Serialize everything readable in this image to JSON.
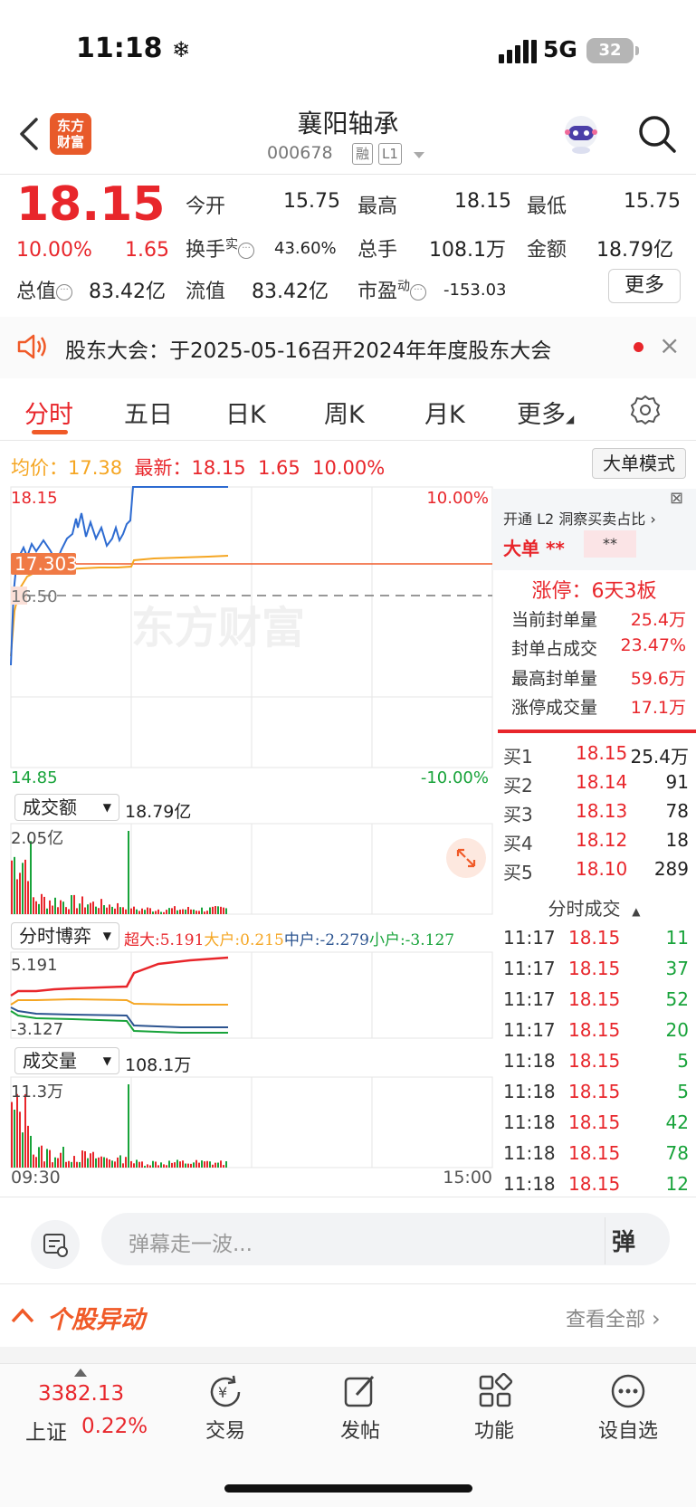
{
  "status": {
    "time": "11:18",
    "network": "5G",
    "battery": "32"
  },
  "header": {
    "logo_line1": "东方",
    "logo_line2": "财富",
    "name": "襄阳轴承",
    "code": "000678",
    "tag_margin": "融",
    "tag_level": "L1"
  },
  "quote": {
    "price": "18.15",
    "pct": "10.00%",
    "change": "1.65",
    "open_label": "今开",
    "open": "15.75",
    "high_label": "最高",
    "high": "18.15",
    "low_label": "最低",
    "low": "15.75",
    "turnover_label": "换手",
    "turnover_sup": "实",
    "turnover": "43.60%",
    "volume_label": "总手",
    "volume": "108.1万",
    "amount_label": "金额",
    "amount": "18.79亿",
    "mktcap_label": "总值",
    "mktcap": "83.42亿",
    "float_label": "流值",
    "float": "83.42亿",
    "pe_label": "市盈",
    "pe_sup": "动",
    "pe": "-153.03",
    "more": "更多"
  },
  "notice": {
    "text": "股东大会：于2025-05-16召开2024年年度股东大会"
  },
  "tabs": [
    "分时",
    "五日",
    "日K",
    "周K",
    "月K",
    "更多"
  ],
  "avg": {
    "avg_label": "均价：",
    "avg": "17.38",
    "last_label": "最新：",
    "last": "18.15",
    "chg": "1.65",
    "pct": "10.00%",
    "mode": "大单模式"
  },
  "chart": {
    "y_top": "18.15",
    "y_top_pct": "10.00%",
    "y_bot": "14.85",
    "y_bot_pct": "-10.00%",
    "cur_tag": "17.303",
    "base": "16.50",
    "watermark": "东方财富",
    "amount_sel": "成交额",
    "amount_val": "18.79亿",
    "amount_max": "2.05亿",
    "game_sel": "分时博弈",
    "game_legend": {
      "super": "超大:5.191",
      "big": "大户:0.215",
      "mid": "中户:-2.279",
      "small": "小户:-3.127"
    },
    "game_max": "5.191",
    "game_min": "-3.127",
    "vol_sel": "成交量",
    "vol_val": "108.1万",
    "vol_max": "11.3万",
    "time_start": "09:30",
    "time_end": "15:00"
  },
  "right_panel": {
    "l2_text": "开通 L2 洞察买卖占比 ›",
    "big_label": "大单",
    "big_stars": "**",
    "big_stars2": "**",
    "limit_title": "涨停：6天3板",
    "limit_rows": [
      {
        "label": "当前封单量",
        "value": "25.4万"
      },
      {
        "label": "封单占成交",
        "value": "23.47%"
      },
      {
        "label": "最高封单量",
        "value": "59.6万"
      },
      {
        "label": "涨停成交量",
        "value": "17.1万"
      }
    ],
    "bids": [
      {
        "n": "买1",
        "p": "18.15",
        "q": "25.4万"
      },
      {
        "n": "买2",
        "p": "18.14",
        "q": "91"
      },
      {
        "n": "买3",
        "p": "18.13",
        "q": "78"
      },
      {
        "n": "买4",
        "p": "18.12",
        "q": "18"
      },
      {
        "n": "买5",
        "p": "18.10",
        "q": "289"
      }
    ],
    "ticks_title": "分时成交",
    "ticks": [
      {
        "t": "11:17",
        "p": "18.15",
        "q": "11"
      },
      {
        "t": "11:17",
        "p": "18.15",
        "q": "37"
      },
      {
        "t": "11:17",
        "p": "18.15",
        "q": "52"
      },
      {
        "t": "11:17",
        "p": "18.15",
        "q": "20"
      },
      {
        "t": "11:18",
        "p": "18.15",
        "q": "5"
      },
      {
        "t": "11:18",
        "p": "18.15",
        "q": "5"
      },
      {
        "t": "11:18",
        "p": "18.15",
        "q": "42"
      },
      {
        "t": "11:18",
        "p": "18.15",
        "q": "78"
      },
      {
        "t": "11:18",
        "p": "18.15",
        "q": "12"
      }
    ]
  },
  "comment": {
    "placeholder": "弹幕走一波...",
    "btn": "弹"
  },
  "section": {
    "title": "个股异动",
    "link": "查看全部"
  },
  "tabbar": {
    "index_val": "3382.13",
    "index_name": "上证",
    "index_pct": "0.22%",
    "items": [
      "交易",
      "发帖",
      "功能",
      "设自选"
    ]
  }
}
